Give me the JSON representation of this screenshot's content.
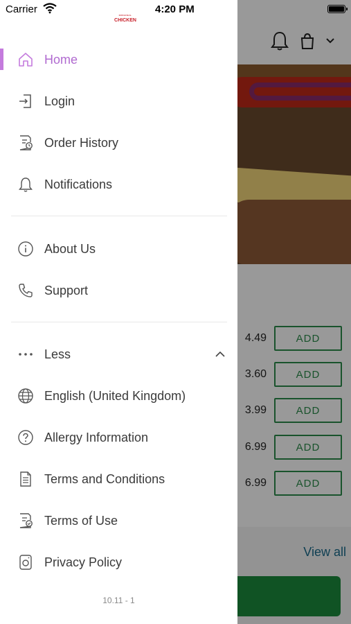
{
  "status_bar": {
    "carrier": "Carrier",
    "time": "4:20 PM"
  },
  "drawer": {
    "logo_text": "CHICKEN",
    "logo_tagline": "ORIGINAL",
    "accent_color": "#c47bdd",
    "primary_items": [
      {
        "label": "Home",
        "icon": "home-icon",
        "active": true
      },
      {
        "label": "Login",
        "icon": "login-icon"
      },
      {
        "label": "Order History",
        "icon": "order-history-icon"
      },
      {
        "label": "Notifications",
        "icon": "bell-icon"
      }
    ],
    "secondary_items": [
      {
        "label": "About Us",
        "icon": "info-icon"
      },
      {
        "label": "Support",
        "icon": "phone-icon"
      }
    ],
    "more_items": [
      {
        "label": "Less",
        "icon": "more-dots-icon"
      },
      {
        "label": "English (United Kingdom)",
        "icon": "globe-icon"
      },
      {
        "label": "Allergy Information",
        "icon": "question-icon"
      },
      {
        "label": "Terms and Conditions",
        "icon": "document-icon"
      },
      {
        "label": "Terms of Use",
        "icon": "document-check-icon"
      },
      {
        "label": "Privacy Policy",
        "icon": "privacy-icon"
      }
    ],
    "version": "10.11 - 1"
  },
  "background": {
    "prices": [
      "4.49",
      "3.60",
      "3.99",
      "6.99",
      "6.99"
    ],
    "add_label": "ADD",
    "view_all_label": "View all"
  }
}
